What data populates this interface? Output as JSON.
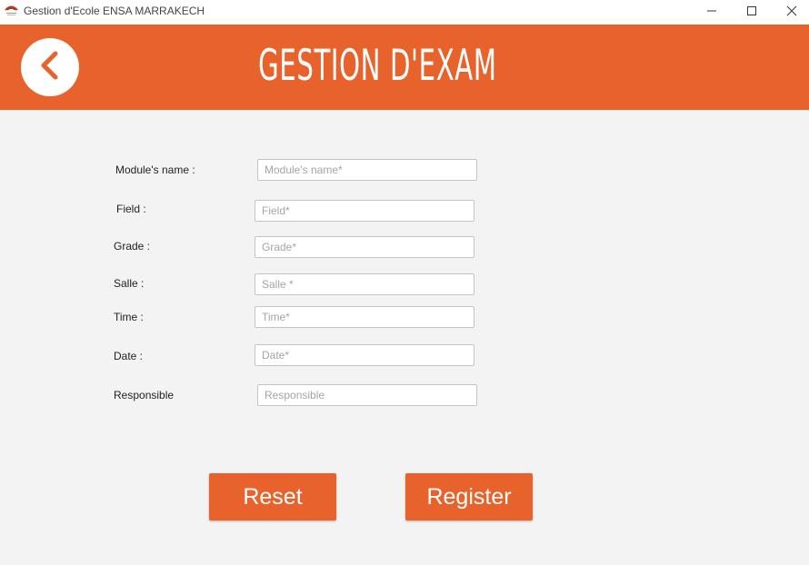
{
  "window": {
    "title": "Gestion d'Ecole ENSA MARRAKECH",
    "icons": {
      "app": "school-roof-icon",
      "minimize": "minimize-icon",
      "maximize": "maximize-icon",
      "close": "close-icon"
    }
  },
  "header": {
    "title": "GESTION D'EXAM",
    "background_color": "#e8632c",
    "back_icon": "chevron-left-icon"
  },
  "form": {
    "module_name": {
      "label": "Module's name :",
      "placeholder": "Module's name*",
      "value": ""
    },
    "field": {
      "label": "Field :",
      "placeholder": "Field*",
      "value": ""
    },
    "grade": {
      "label": "Grade :",
      "placeholder": "Grade*",
      "value": ""
    },
    "salle": {
      "label": "Salle :",
      "placeholder": "Salle *",
      "value": ""
    },
    "time": {
      "label": "Time :",
      "placeholder": "Time*",
      "value": ""
    },
    "date": {
      "label": "Date :",
      "placeholder": "Date*",
      "value": ""
    },
    "responsible": {
      "label": "Responsible",
      "placeholder": "Responsible",
      "value": ""
    }
  },
  "buttons": {
    "reset": "Reset",
    "register": "Register"
  },
  "colors": {
    "accent": "#e8632c",
    "background": "#f3f3f3"
  }
}
